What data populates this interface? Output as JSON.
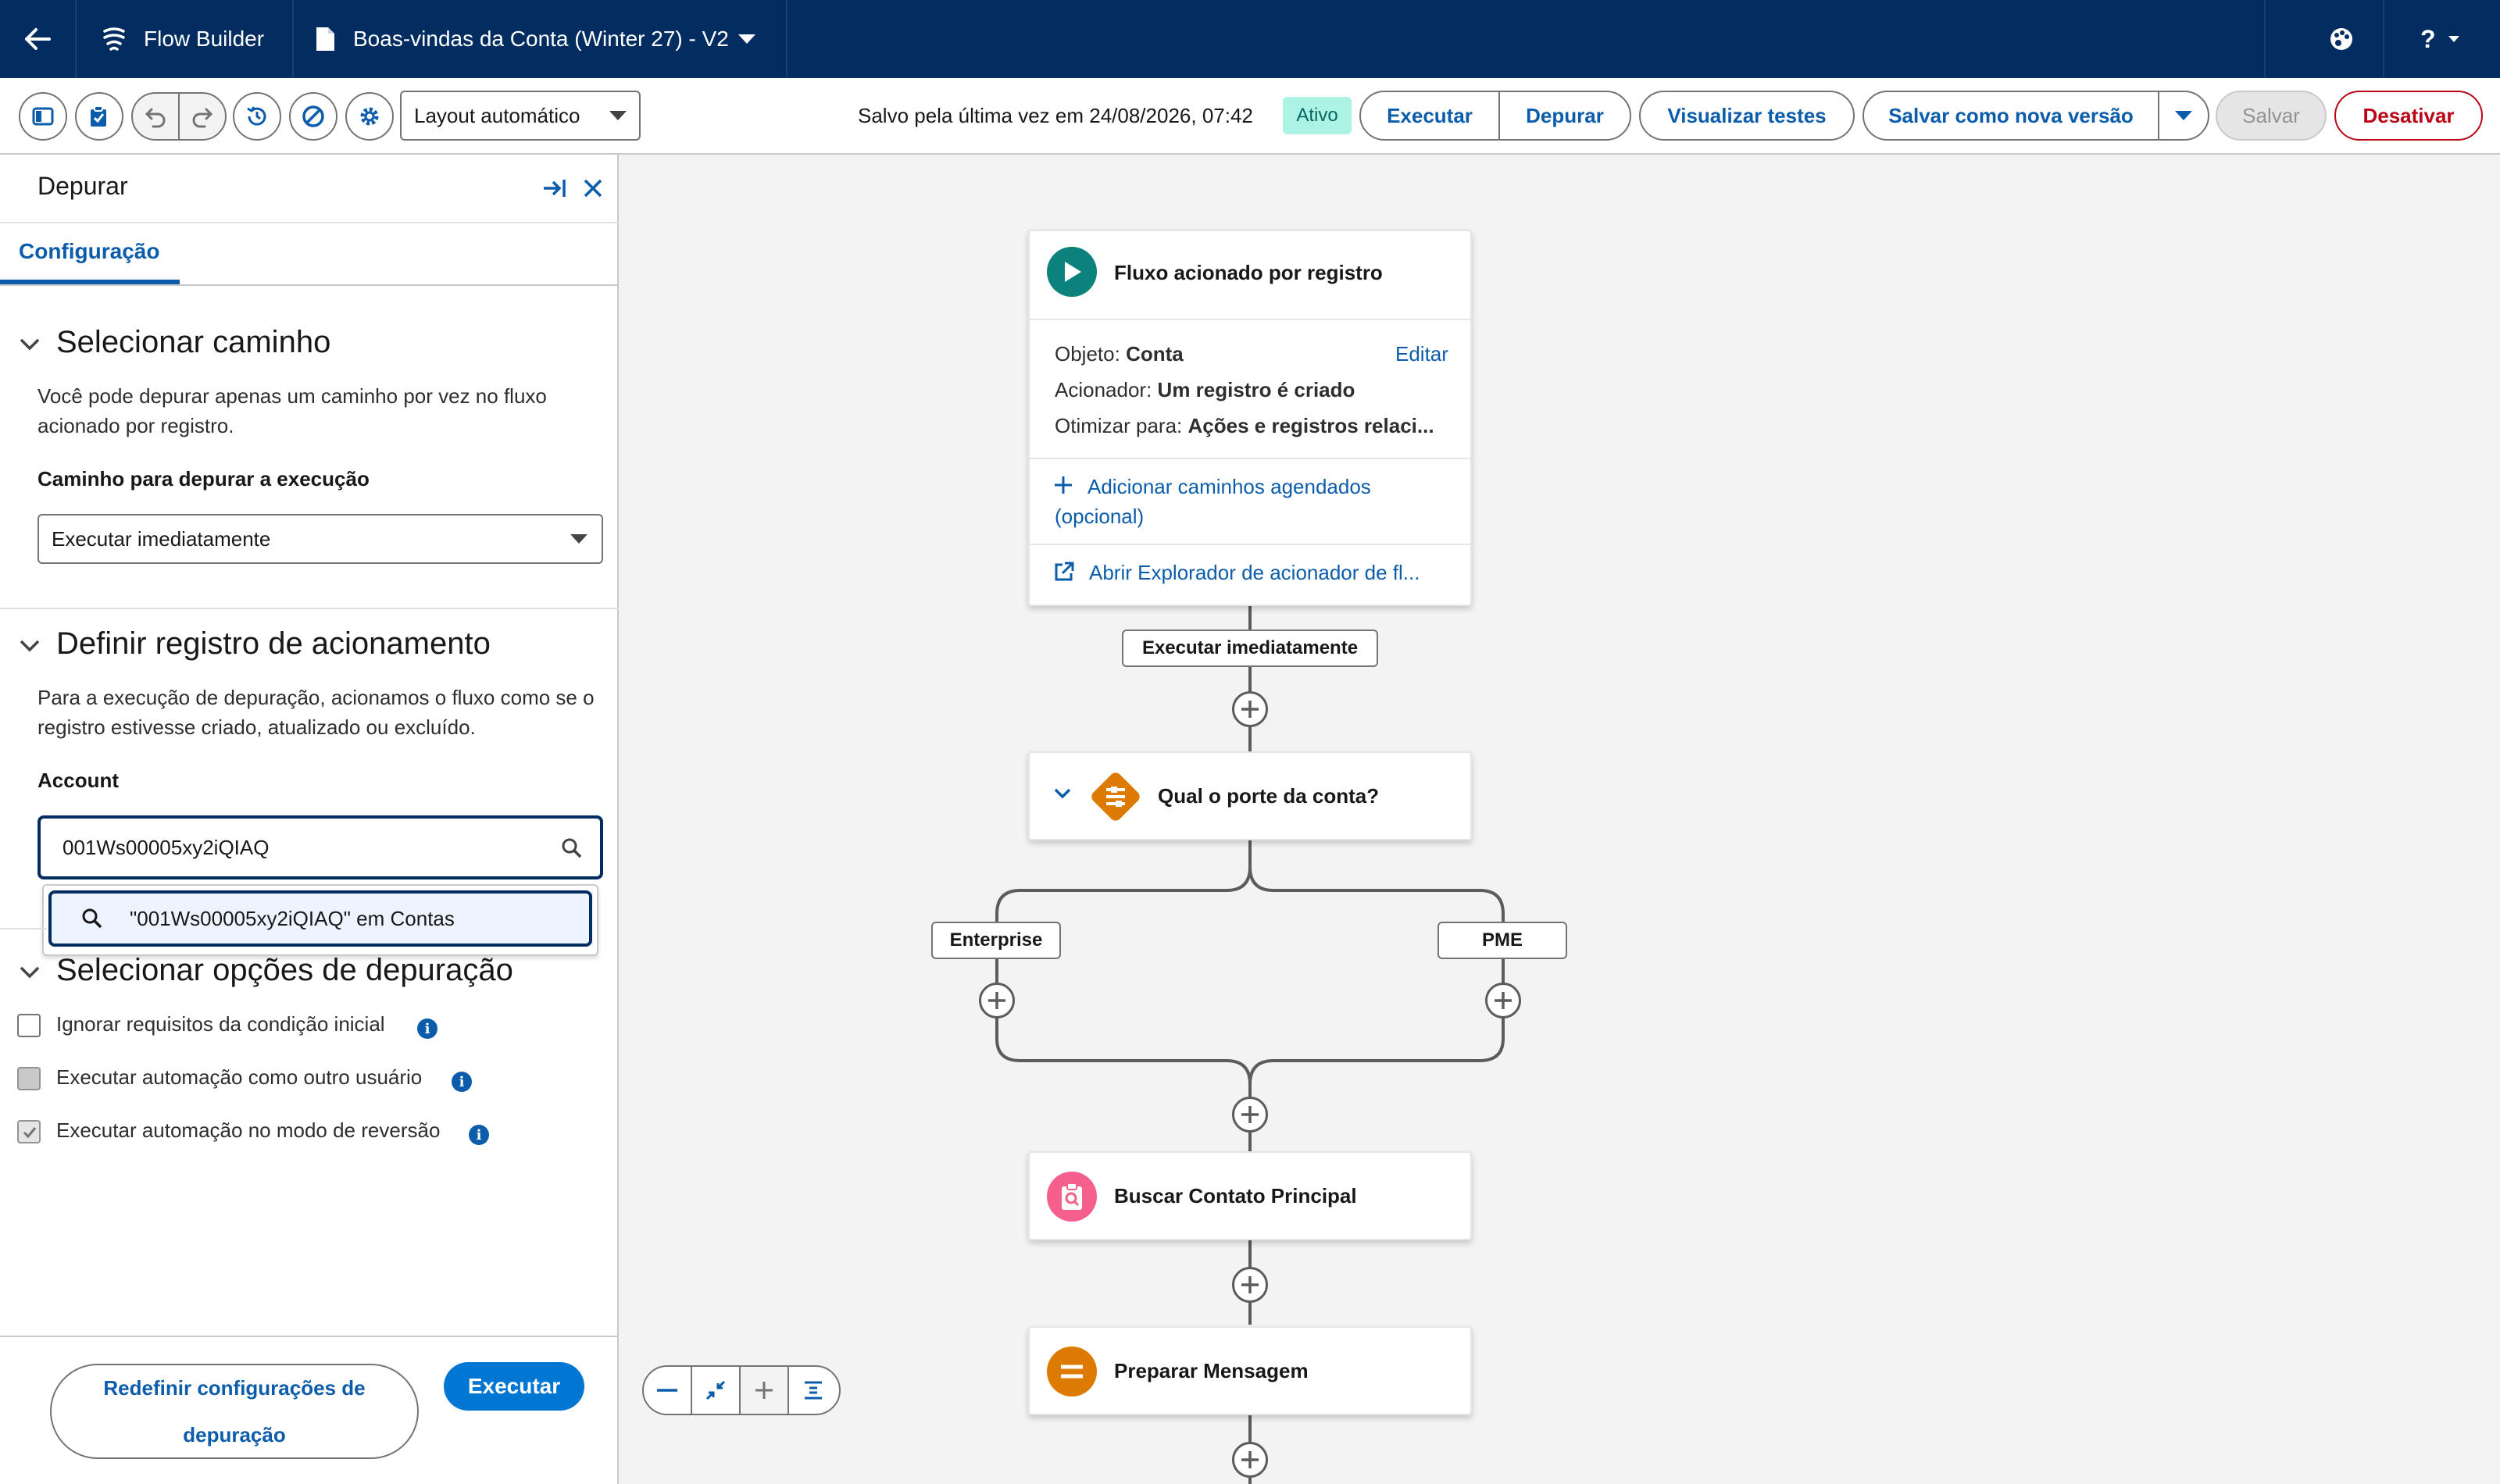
{
  "topbar": {
    "app_name": "Flow Builder",
    "flow_title": "Boas-vindas da Conta (Winter 27) - V2",
    "help_label": "?"
  },
  "toolbar": {
    "layout_select": "Layout automático",
    "saved_text": "Salvo pela última vez em 24/08/2026, 07:42",
    "status_badge": "Ativo",
    "run_label": "Executar",
    "debug_label": "Depurar",
    "view_tests_label": "Visualizar testes",
    "save_new_version_label": "Salvar como nova versão",
    "save_label": "Salvar",
    "deactivate_label": "Desativar"
  },
  "debug_panel": {
    "title": "Depurar",
    "tab": "Configuração",
    "section1": {
      "title": "Selecionar caminho",
      "description": "Você pode depurar apenas um caminho por vez no fluxo acionado por registro.",
      "path_label": "Caminho para depurar a execução",
      "path_value": "Executar imediatamente"
    },
    "section2": {
      "title": "Definir registro de acionamento",
      "description": "Para a execução de depuração, acionamos o fluxo como se o registro estivesse criado, atualizado ou excluído.",
      "record_label": "Account",
      "record_value": "001Ws00005xy2iQIAQ",
      "suggestion": "\"001Ws00005xy2iQIAQ\" em Contas"
    },
    "section3": {
      "title": "Selecionar opções de depuração",
      "options": [
        {
          "label": "Ignorar requisitos da condição inicial",
          "checked": false
        },
        {
          "label": "Executar automação como outro usuário",
          "checked": false
        },
        {
          "label": "Executar automação no modo de reversão",
          "checked": true
        }
      ]
    },
    "reset_label": "Redefinir configurações de depuração",
    "run_label": "Executar"
  },
  "canvas": {
    "start": {
      "title": "Fluxo acionado por registro",
      "object_label": "Objeto:",
      "object_value": "Conta",
      "edit_label": "Editar",
      "trigger_label": "Acionador:",
      "trigger_value": "Um registro é criado",
      "optimize_label": "Otimizar para:",
      "optimize_value": "Ações e registros relaci...",
      "add_scheduled": "Adicionar caminhos agendados (opcional)",
      "open_explorer": "Abrir Explorador de acionador de fl..."
    },
    "path_label": "Executar imediatamente",
    "decision": {
      "title": "Qual o porte da conta?"
    },
    "branches": [
      "Enterprise",
      "PME"
    ],
    "get_records": {
      "title": "Buscar Contato Principal"
    },
    "assignment": {
      "title": "Preparar Mensagem"
    }
  },
  "colors": {
    "header_bg": "#032d60",
    "brand_blue": "#0b5cab",
    "primary_button": "#0176d3",
    "deactivate": "#ba0517",
    "start_icon": "#0b827c",
    "decision_icon": "#dd7a01",
    "get_records_icon": "#f4608b",
    "assignment_icon": "#dd7a01",
    "active_badge": "#acf3e4"
  }
}
